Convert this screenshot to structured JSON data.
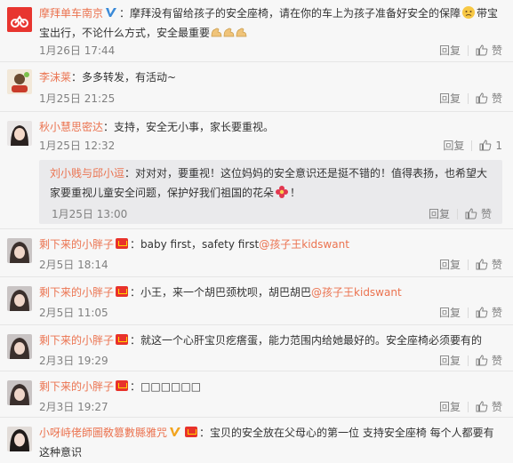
{
  "comments": [
    {
      "author": "摩拜单车南京",
      "text_a": "：摩拜没有留给孩子的安全座椅，请在你的车上为孩子准备好安全的保障",
      "text_b": "带宝宝出行，不论什么方式，安全最重要",
      "time": "1月26日 17:44",
      "reply": "回复",
      "like": "赞",
      "verified": true
    },
    {
      "author": "李沫莱",
      "text_a": "：多多转发，有活动~",
      "time": "1月25日 21:25",
      "reply": "回复",
      "like": "赞"
    },
    {
      "author": "秋小慧思密达",
      "text_a": "：支持，安全无小事，家长要重视。",
      "time": "1月25日 12:32",
      "reply": "回复",
      "like_count": "1",
      "nested": {
        "author": "刘小贱与邱小逗",
        "text_a": "：对对对，要重视！这位妈妈的安全意识还是挺不错的！值得表扬，也希望大家要重视儿童安全问题，保护好我们祖国的花朵",
        "text_b": "！",
        "time": "1月25日 13:00",
        "reply": "回复",
        "like": "赞"
      }
    },
    {
      "author": "剩下来的小胖子",
      "text_a": "：baby first，safety first",
      "mention": "@孩子王kidswant",
      "time": "2月5日 18:14",
      "reply": "回复",
      "like": "赞"
    },
    {
      "author": "剩下来的小胖子",
      "text_a": "：小王，来一个胡巴颈枕呗，胡巴胡巴",
      "mention": "@孩子王kidswant",
      "time": "2月5日 11:05",
      "reply": "回复",
      "like": "赞"
    },
    {
      "author": "剩下来的小胖子",
      "text_a": "：就这一个心肝宝贝疙瘩蛋，能力范围内给她最好的。安全座椅必须要有的",
      "time": "2月3日 19:29",
      "reply": "回复",
      "like": "赞"
    },
    {
      "author": "剩下来的小胖子",
      "text_a": "：□□□□□□",
      "time": "2月3日 19:27",
      "reply": "回复",
      "like": "赞"
    },
    {
      "author": "小呀峙佬師圖敎篡數縣雅咒",
      "text_a": "：宝贝的安全放在父母心的第一位 支持安全座椅 每个人都要有这种意识",
      "verified_yellow": true
    }
  ],
  "colors": {
    "name": "#eb7350",
    "text": "#333333",
    "meta": "#808080",
    "nested_bg": "#eaeaec"
  }
}
